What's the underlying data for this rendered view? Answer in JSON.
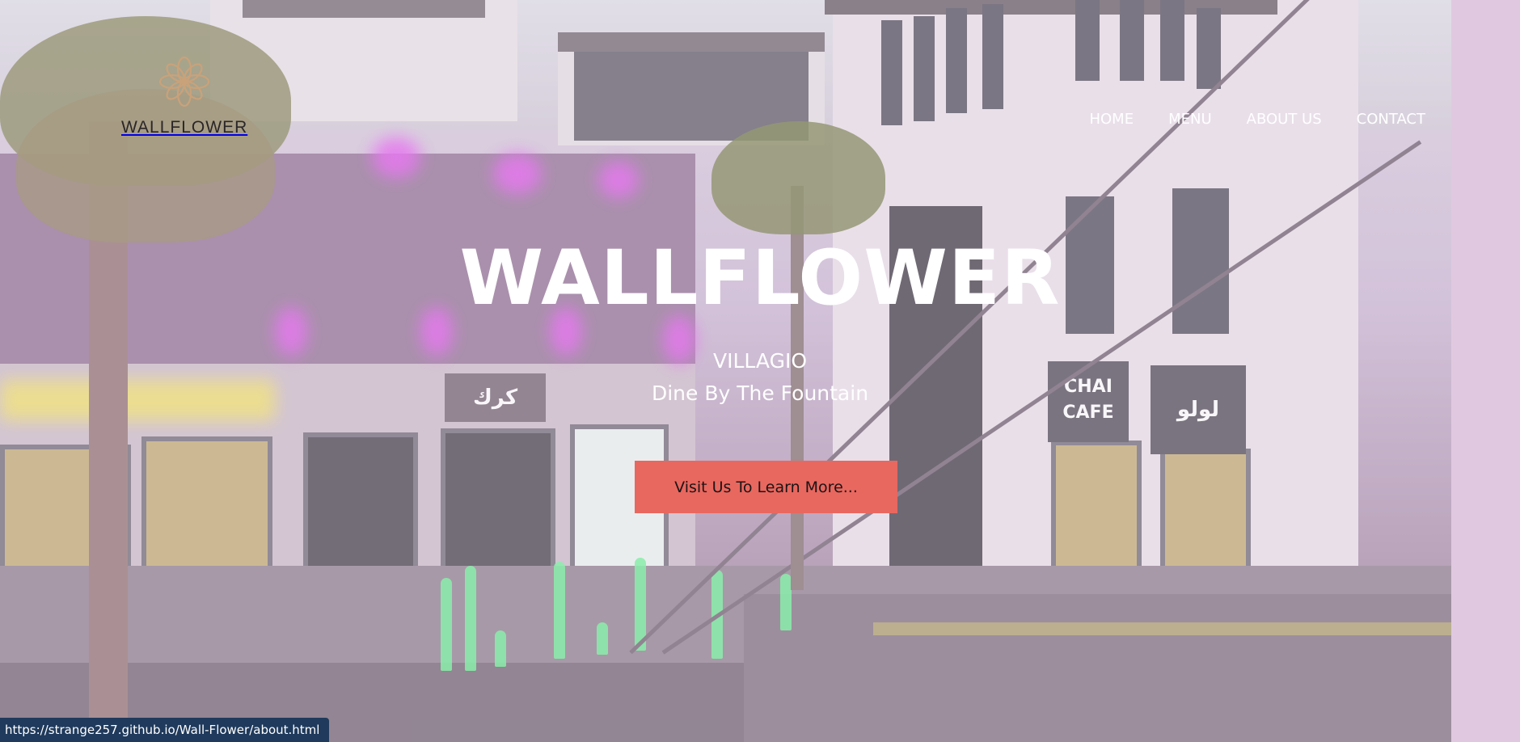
{
  "logo": {
    "text": "WALLFLOWER",
    "icon": "flower-icon",
    "icon_color": "#c9a27a"
  },
  "nav": {
    "items": [
      {
        "label": "HOME"
      },
      {
        "label": "MENU"
      },
      {
        "label": "ABOUT US"
      },
      {
        "label": "CONTACT"
      }
    ]
  },
  "hero": {
    "title": "WALLFLOWER",
    "subtitle_1": "VILLAGIO",
    "subtitle_2": "Dine By The Fountain",
    "cta_label": "Visit Us To Learn More...",
    "cta_color": "#e8685f"
  },
  "status_bar": {
    "url": "https://strange257.github.io/Wall-Flower/about.html"
  },
  "background": {
    "signs": [
      "كرك",
      "CHAI CAFE",
      "لولو"
    ]
  }
}
